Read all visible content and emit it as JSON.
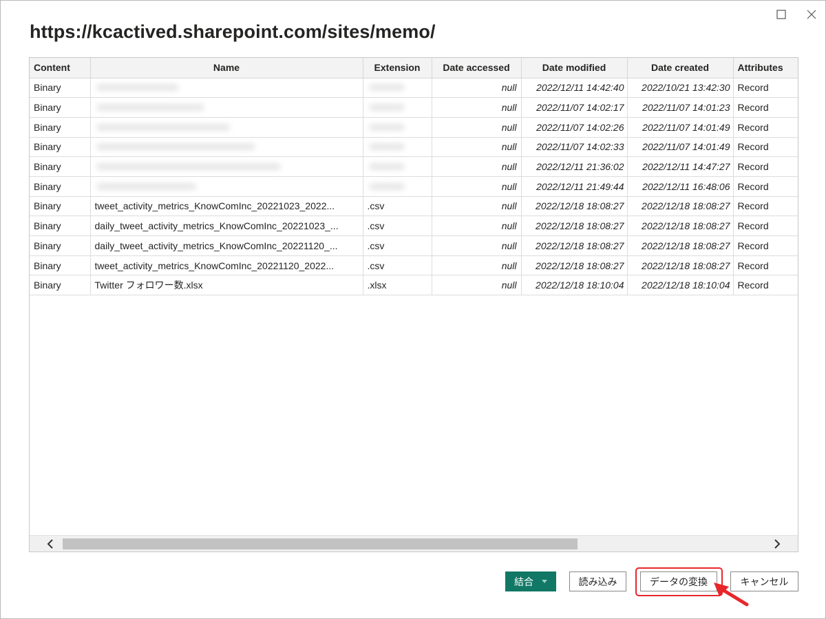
{
  "window": {
    "title": "https://kcactived.sharepoint.com/sites/memo/",
    "maximize_icon": "maximize-icon",
    "close_icon": "close-icon"
  },
  "table": {
    "columns": [
      "Content",
      "Name",
      "Extension",
      "Date accessed",
      "Date modified",
      "Date created",
      "Attributes"
    ],
    "rows": [
      {
        "content": "Binary",
        "name": "",
        "extension": "",
        "accessed": "null",
        "modified": "2022/12/11 14:42:40",
        "created": "2022/10/21 13:42:30",
        "attributes": "Record",
        "redacted": true
      },
      {
        "content": "Binary",
        "name": "",
        "extension": "",
        "accessed": "null",
        "modified": "2022/11/07 14:02:17",
        "created": "2022/11/07 14:01:23",
        "attributes": "Record",
        "redacted": true
      },
      {
        "content": "Binary",
        "name": "",
        "extension": "",
        "accessed": "null",
        "modified": "2022/11/07 14:02:26",
        "created": "2022/11/07 14:01:49",
        "attributes": "Record",
        "redacted": true
      },
      {
        "content": "Binary",
        "name": "",
        "extension": "",
        "accessed": "null",
        "modified": "2022/11/07 14:02:33",
        "created": "2022/11/07 14:01:49",
        "attributes": "Record",
        "redacted": true
      },
      {
        "content": "Binary",
        "name": "",
        "extension": "",
        "accessed": "null",
        "modified": "2022/12/11 21:36:02",
        "created": "2022/12/11 14:47:27",
        "attributes": "Record",
        "redacted": true
      },
      {
        "content": "Binary",
        "name": "",
        "extension": "",
        "accessed": "null",
        "modified": "2022/12/11 21:49:44",
        "created": "2022/12/11 16:48:06",
        "attributes": "Record",
        "redacted": true
      },
      {
        "content": "Binary",
        "name": "tweet_activity_metrics_KnowComInc_20221023_2022...",
        "extension": ".csv",
        "accessed": "null",
        "modified": "2022/12/18 18:08:27",
        "created": "2022/12/18 18:08:27",
        "attributes": "Record",
        "redacted": false
      },
      {
        "content": "Binary",
        "name": "daily_tweet_activity_metrics_KnowComInc_20221023_...",
        "extension": ".csv",
        "accessed": "null",
        "modified": "2022/12/18 18:08:27",
        "created": "2022/12/18 18:08:27",
        "attributes": "Record",
        "redacted": false
      },
      {
        "content": "Binary",
        "name": "daily_tweet_activity_metrics_KnowComInc_20221120_...",
        "extension": ".csv",
        "accessed": "null",
        "modified": "2022/12/18 18:08:27",
        "created": "2022/12/18 18:08:27",
        "attributes": "Record",
        "redacted": false
      },
      {
        "content": "Binary",
        "name": "tweet_activity_metrics_KnowComInc_20221120_2022...",
        "extension": ".csv",
        "accessed": "null",
        "modified": "2022/12/18 18:08:27",
        "created": "2022/12/18 18:08:27",
        "attributes": "Record",
        "redacted": false
      },
      {
        "content": "Binary",
        "name": "Twitter フォロワー数.xlsx",
        "extension": ".xlsx",
        "accessed": "null",
        "modified": "2022/12/18 18:10:04",
        "created": "2022/12/18 18:10:04",
        "attributes": "Record",
        "redacted": false
      }
    ]
  },
  "scrollbar": {
    "left_icon": "chevron-left-icon",
    "right_icon": "chevron-right-icon"
  },
  "buttons": {
    "combine": "結合",
    "load": "読み込み",
    "transform": "データの変換",
    "cancel": "キャンセル"
  },
  "colors": {
    "accent": "#117865",
    "highlight": "#e8262a"
  }
}
